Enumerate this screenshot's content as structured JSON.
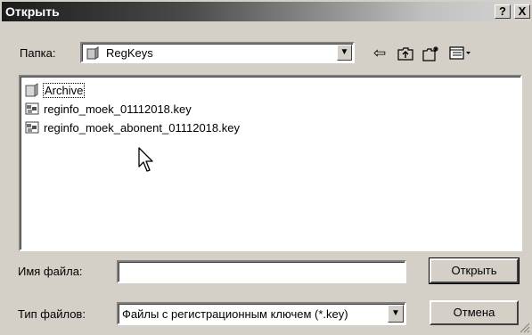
{
  "window": {
    "title": "Открыть",
    "help_label": "?",
    "close_label": "X"
  },
  "folder": {
    "label": "Папка:",
    "value": "RegKeys",
    "icon": "folder-icon"
  },
  "toolbar": {
    "back_icon": "back-arrow-icon",
    "up_icon": "up-folder-icon",
    "new_folder_icon": "new-folder-icon",
    "view_menu_icon": "view-menu-icon"
  },
  "files": [
    {
      "name": "Archive",
      "icon": "folder-icon"
    },
    {
      "name": "reginfo_moek_01112018.key",
      "icon": "registry-file-icon"
    },
    {
      "name": "reginfo_moek_abonent_01112018.key",
      "icon": "registry-file-icon"
    }
  ],
  "filename": {
    "label": "Имя файла:",
    "value": ""
  },
  "filetype": {
    "label": "Тип файлов:",
    "value": "Файлы с регистрационным ключем (*.key)"
  },
  "buttons": {
    "open": "Открыть",
    "cancel": "Отмена"
  }
}
